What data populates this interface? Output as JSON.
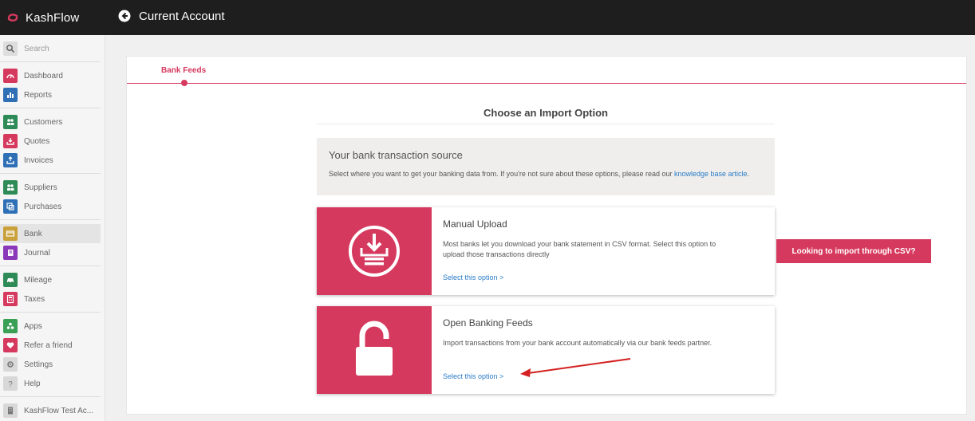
{
  "app": {
    "name": "KashFlow"
  },
  "header": {
    "account_title": "Current Account"
  },
  "sidebar": {
    "search_label": "Search",
    "items": [
      {
        "label": "Dashboard",
        "icon": "gauge-icon",
        "color": "#d6395e"
      },
      {
        "label": "Reports",
        "icon": "bar-chart-icon",
        "color": "#2f6fb6"
      },
      {
        "label": "Customers",
        "icon": "people-icon",
        "color": "#2e8b57"
      },
      {
        "label": "Quotes",
        "icon": "inbox-icon",
        "color": "#d6395e"
      },
      {
        "label": "Invoices",
        "icon": "tray-icon",
        "color": "#2f6fb6"
      },
      {
        "label": "Suppliers",
        "icon": "people-icon",
        "color": "#2e8b57"
      },
      {
        "label": "Purchases",
        "icon": "copy-icon",
        "color": "#2f6fb6"
      },
      {
        "label": "Bank",
        "icon": "bank-card-icon",
        "color": "#c9a03a"
      },
      {
        "label": "Journal",
        "icon": "book-icon",
        "color": "#8a3ab9"
      },
      {
        "label": "Mileage",
        "icon": "car-icon",
        "color": "#2e8b57"
      },
      {
        "label": "Taxes",
        "icon": "calculator-icon",
        "color": "#d6395e"
      },
      {
        "label": "Apps",
        "icon": "apps-icon",
        "color": "#3aa055"
      },
      {
        "label": "Refer a friend",
        "icon": "heart-icon",
        "color": "#d6395e"
      },
      {
        "label": "Settings",
        "icon": "gear-icon",
        "color": "#999999"
      },
      {
        "label": "Help",
        "icon": "question-icon",
        "color": "#999999"
      },
      {
        "label": "KashFlow Test Ac...",
        "icon": "building-icon",
        "color": "#888888"
      }
    ]
  },
  "tabs": {
    "active": "Bank Feeds"
  },
  "main": {
    "section_title": "Choose an Import Option",
    "source": {
      "heading": "Your bank transaction source",
      "text": "Select where you want to get your banking data from. If you're not sure about these options, please read our ",
      "link": "knowledge base article",
      "end": "."
    },
    "options": [
      {
        "title": "Manual Upload",
        "description": "Most banks let you download your bank statement in CSV format. Select this option to upload those transactions directly",
        "link": "Select this option >",
        "icon": "download-tray-icon"
      },
      {
        "title": "Open Banking Feeds",
        "description": "Import transactions from your bank account automatically via our bank feeds partner.",
        "link": "Select this option >",
        "icon": "unlocked-padlock-icon"
      }
    ],
    "csv_button": "Looking to import through CSV?"
  },
  "colors": {
    "accent": "#d6395e",
    "link": "#2a7cc7",
    "topbar": "#1e1e1e"
  }
}
